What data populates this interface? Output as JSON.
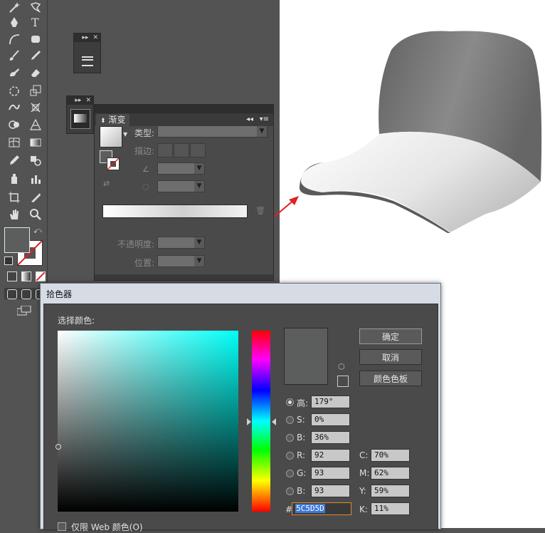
{
  "gradient_panel": {
    "tab_label": "渐变",
    "type_label": "类型:",
    "stroke_label": "描边:",
    "opacity_label": "不透明度:",
    "location_label": "位置:"
  },
  "color_picker": {
    "title": "拾色器",
    "select_label": "选择颜色:",
    "ok_label": "确定",
    "cancel_label": "取消",
    "swatches_label": "颜色色板",
    "hsb": {
      "h_label": "高:",
      "h": "179°",
      "s_label": "S:",
      "s": "0%",
      "b_label": "B:",
      "b": "36%"
    },
    "rgb": {
      "r_label": "R:",
      "r": "92",
      "g_label": "G:",
      "g": "93",
      "b_label": "B:",
      "b": "93"
    },
    "cmyk": {
      "c_label": "C:",
      "c": "70%",
      "m_label": "M:",
      "m": "62%",
      "y_label": "Y:",
      "y": "59%",
      "k_label": "K:",
      "k": "11%"
    },
    "hex_label": "#",
    "hex": "5C5D5D",
    "web_only_label": "仅限 Web 颜色(O)"
  },
  "colors": {
    "current_color": "#5c5d5d",
    "ui_background": "#535353",
    "accent_arrow": "#e02020"
  }
}
